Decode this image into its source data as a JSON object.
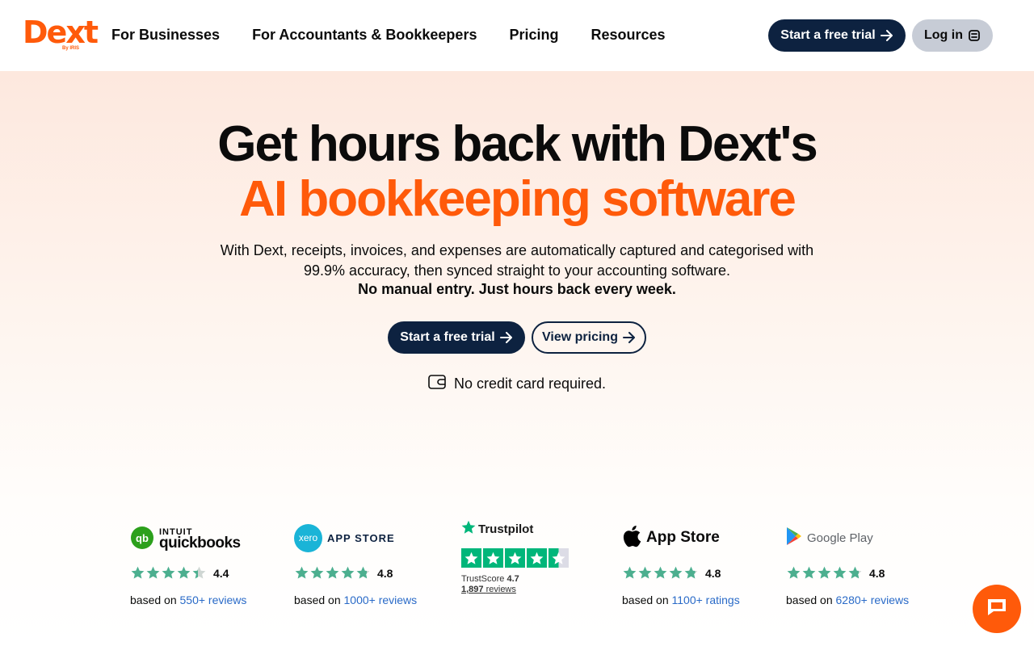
{
  "brand": {
    "name": "Dext",
    "sub": "By IRIS",
    "color": "#ff5a0a"
  },
  "nav": {
    "items": [
      "For Businesses",
      "For Accountants & Bookkeepers",
      "Pricing",
      "Resources"
    ],
    "trial_label": "Start a free trial",
    "login_label": "Log in"
  },
  "hero": {
    "title_line1": "Get hours back with Dext's",
    "title_line2": "AI bookkeeping software",
    "subtitle": "With Dext, receipts, invoices, and expenses are automatically captured and categorised with 99.9% accuracy, then synced straight to your accounting software.",
    "subtitle_bold": "No manual entry. Just hours back every week.",
    "trial_label": "Start a free trial",
    "pricing_label": "View pricing",
    "no_card": "No credit card required."
  },
  "ratings": [
    {
      "source": "quickbooks",
      "logo_top": "INTUIT",
      "logo_main": "quickbooks",
      "stars": 4.4,
      "score": "4.4",
      "based_prefix": "based on",
      "based_link": "550+ reviews"
    },
    {
      "source": "xero",
      "logo_badge": "xero",
      "logo_main": "APP STORE",
      "stars": 4.8,
      "score": "4.8",
      "based_prefix": "based on",
      "based_link": "1000+ reviews"
    },
    {
      "source": "trustpilot",
      "logo_main": "Trustpilot",
      "stars": 4.7,
      "trustscore_label": "TrustScore",
      "trustscore": "4.7",
      "reviews_count": "1,897",
      "reviews_label": "reviews"
    },
    {
      "source": "apple",
      "logo_main": "App Store",
      "stars": 4.8,
      "score": "4.8",
      "based_prefix": "based on",
      "based_link": "1100+ ratings"
    },
    {
      "source": "google",
      "logo_main": "Google Play",
      "stars": 4.8,
      "score": "4.8",
      "based_prefix": "based on",
      "based_link": "6280+ reviews"
    }
  ],
  "colors": {
    "navy": "#0d2240",
    "orange": "#ff5a0a",
    "star_green": "#4caf8f",
    "trustpilot_green": "#00b67a",
    "link_blue": "#2a6ac8"
  },
  "chat": {
    "icon": "chat-bubble-icon"
  }
}
